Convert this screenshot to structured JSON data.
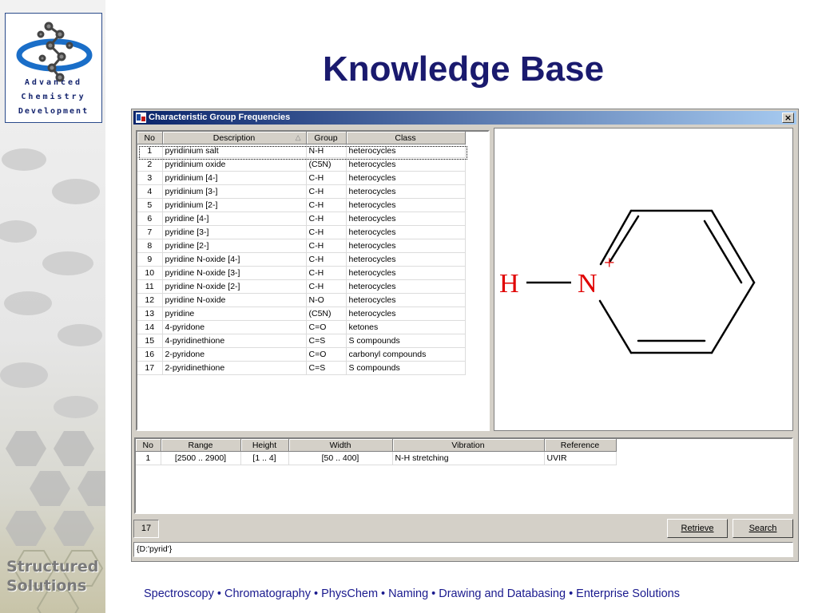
{
  "slide": {
    "title": "Knowledge Base",
    "footer": "Spectroscopy  • Chromatography • PhysChem • Naming • Drawing and Databasing • Enterprise Solutions",
    "logo_lines": [
      "Advanced",
      "Chemistry",
      "Development"
    ],
    "side_label_1": "Structured",
    "side_label_2": "Solutions"
  },
  "window": {
    "title": "Characteristic Group Frequencies",
    "close": "×"
  },
  "groups": {
    "columns": [
      "No",
      "Description",
      "Group",
      "Class"
    ],
    "selected_index": 0,
    "rows": [
      {
        "no": "1",
        "desc": "pyridinium salt",
        "group": "N-H",
        "cls": "heterocycles"
      },
      {
        "no": "2",
        "desc": "pyridinium oxide",
        "group": "(C5N)",
        "cls": "heterocycles"
      },
      {
        "no": "3",
        "desc": "pyridinium [4-]",
        "group": "C-H",
        "cls": "heterocycles"
      },
      {
        "no": "4",
        "desc": "pyridinium [3-]",
        "group": "C-H",
        "cls": "heterocycles"
      },
      {
        "no": "5",
        "desc": "pyridinium [2-]",
        "group": "C-H",
        "cls": "heterocycles"
      },
      {
        "no": "6",
        "desc": "pyridine [4-]",
        "group": "C-H",
        "cls": "heterocycles"
      },
      {
        "no": "7",
        "desc": "pyridine [3-]",
        "group": "C-H",
        "cls": "heterocycles"
      },
      {
        "no": "8",
        "desc": "pyridine [2-]",
        "group": "C-H",
        "cls": "heterocycles"
      },
      {
        "no": "9",
        "desc": "pyridine N-oxide [4-]",
        "group": "C-H",
        "cls": "heterocycles"
      },
      {
        "no": "10",
        "desc": "pyridine N-oxide [3-]",
        "group": "C-H",
        "cls": "heterocycles"
      },
      {
        "no": "11",
        "desc": "pyridine N-oxide [2-]",
        "group": "C-H",
        "cls": "heterocycles"
      },
      {
        "no": "12",
        "desc": "pyridine N-oxide",
        "group": "N-O",
        "cls": "heterocycles"
      },
      {
        "no": "13",
        "desc": "pyridine",
        "group": "(C5N)",
        "cls": "heterocycles"
      },
      {
        "no": "14",
        "desc": "4-pyridone",
        "group": "C=O",
        "cls": "ketones"
      },
      {
        "no": "15",
        "desc": "4-pyridinethione",
        "group": "C=S",
        "cls": "S compounds"
      },
      {
        "no": "16",
        "desc": "2-pyridone",
        "group": "C=O",
        "cls": "carbonyl compounds"
      },
      {
        "no": "17",
        "desc": "2-pyridinethione",
        "group": "C=S",
        "cls": "S compounds"
      }
    ]
  },
  "structure": {
    "atom_h": "H",
    "atom_n": "N",
    "charge": "+"
  },
  "vibrations": {
    "columns": [
      "No",
      "Range",
      "Height",
      "Width",
      "Vibration",
      "Reference"
    ],
    "rows": [
      {
        "no": "1",
        "range": "[2500 .. 2900]",
        "height": "[1 .. 4]",
        "width": "[50 .. 400]",
        "vibration": "N-H stretching",
        "reference": "UVIR"
      }
    ]
  },
  "status": {
    "count": "17",
    "retrieve_label": "Retrieve",
    "search_label": "Search",
    "query": "{D:'pyrid'}"
  }
}
